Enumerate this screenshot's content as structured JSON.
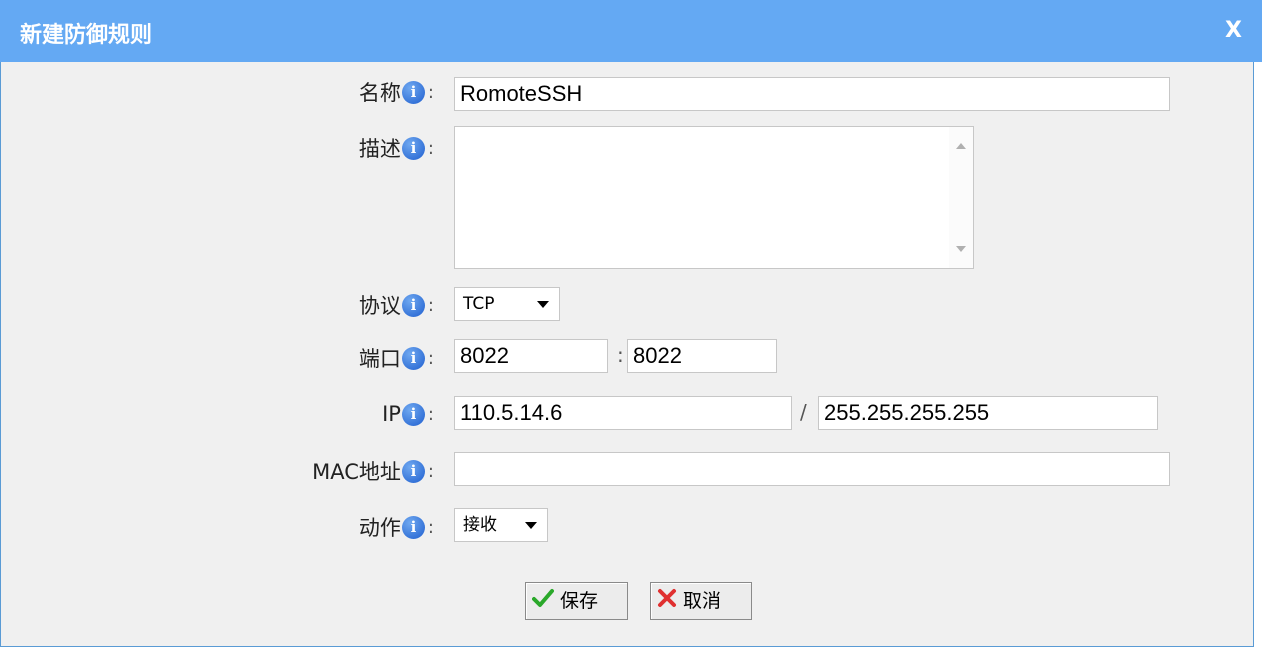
{
  "dialog": {
    "title": "新建防御规则",
    "close_label": "X"
  },
  "form": {
    "name": {
      "label": "名称",
      "value": "RomoteSSH"
    },
    "description": {
      "label": "描述",
      "value": ""
    },
    "protocol": {
      "label": "协议",
      "selected": "TCP"
    },
    "port": {
      "label": "端口",
      "start": "8022",
      "separator": ":",
      "end": "8022"
    },
    "ip": {
      "label": "IP",
      "address": "110.5.14.6",
      "separator": "/",
      "mask": "255.255.255.255"
    },
    "mac": {
      "label": "MAC地址",
      "value": ""
    },
    "action": {
      "label": "动作",
      "selected": "接收"
    },
    "colon": ":",
    "info_glyph": "i"
  },
  "buttons": {
    "save": "保存",
    "cancel": "取消"
  },
  "colors": {
    "titlebar": "#64a9f3",
    "save_check": "#2aa82a",
    "cancel_x": "#e03030"
  },
  "icons": {
    "info": "info-icon",
    "save": "check-icon",
    "cancel": "x-mark-icon"
  }
}
